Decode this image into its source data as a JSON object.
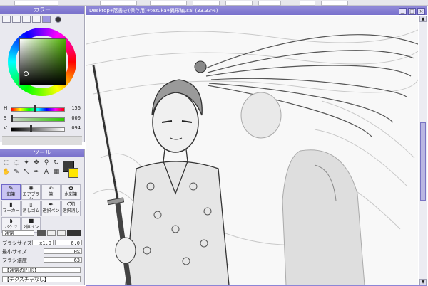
{
  "color_panel": {
    "title": "カラー",
    "h_label": "H",
    "h_value": "156",
    "s_label": "S",
    "s_value": "000",
    "v_label": "V",
    "v_value": "094",
    "hue_fraction": 0.43,
    "sat_fraction": 0.0,
    "val_fraction": 0.37
  },
  "tool_panel": {
    "title": "ツール",
    "brushes": [
      {
        "label": "鉛筆",
        "selected": true
      },
      {
        "label": "エアブラシ",
        "selected": false
      },
      {
        "label": "筆",
        "selected": false
      },
      {
        "label": "水彩筆",
        "selected": false
      },
      {
        "label": "マーカー",
        "selected": false
      },
      {
        "label": "消しゴム",
        "selected": false
      },
      {
        "label": "選択ペン",
        "selected": false
      },
      {
        "label": "選択消し",
        "selected": false
      },
      {
        "label": "バケツ",
        "selected": false
      },
      {
        "label": "2値ペン",
        "selected": false
      }
    ],
    "blend_mode": "通常",
    "brush_size_label": "ブラシサイズ",
    "brush_size_mult": "x1.0",
    "brush_size_value": "6.0",
    "min_size_label": "最小サイズ",
    "min_size_value": "0%",
    "density_label": "ブラシ濃度",
    "density_value": "63",
    "shape_option": "【通常の円形】",
    "texture_option": "【テクスチャなし】"
  },
  "canvas_window": {
    "title": "Desktop¥落書き(保存用)¥tezuka¥異形編.sai (33.33%)"
  },
  "icons": {
    "minimize": "minimize-icon",
    "maximize": "maximize-icon",
    "close": "close-icon"
  },
  "colors": {
    "accent": "#7a72cc",
    "background_color": "#ffe600",
    "foreground_color": "#3a3a3a"
  }
}
